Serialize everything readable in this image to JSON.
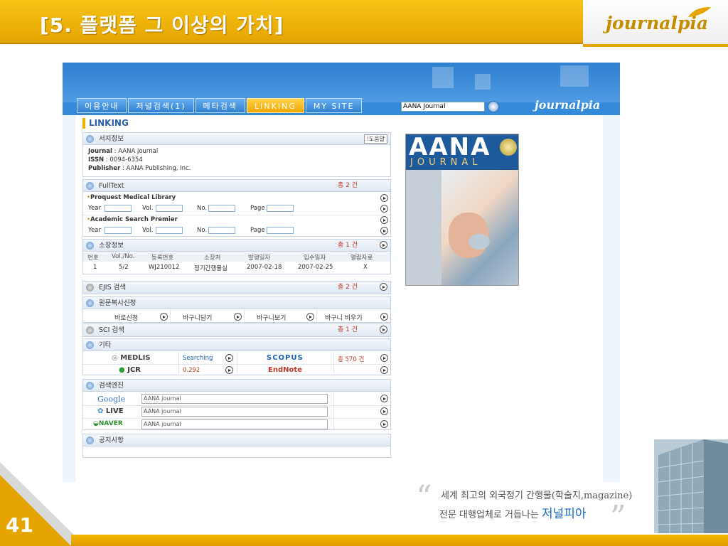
{
  "slide": {
    "title": "[5. 플랫폼 그 이상의 가치]",
    "logo": "journalpia",
    "page_number": "41",
    "quote_line1": "세계 최고의 외국정기 간행물(학술지,magazine)",
    "quote_line2_prefix": "전문 대행업체로 거듭나는 ",
    "quote_line2_highlight": "저널피아",
    "colors": {
      "accent": "#e5a400",
      "blue": "#2f7fd0"
    }
  },
  "site": {
    "nav": [
      "이용안내",
      "저널검색(1)",
      "메타검색",
      "LINKING",
      "MY SITE"
    ],
    "active_nav": "LINKING",
    "search_value": "AANA Journal",
    "logo": "journalpia",
    "page_heading": "LINKING"
  },
  "bib": {
    "title": "서지정보",
    "help": "도움말",
    "journal_label": "Journal",
    "journal_value": ": AANA journal",
    "issn_label": "ISSN",
    "issn_value": ": 0094-6354",
    "publisher_label": "Publisher",
    "publisher_value": ": AANA Publishing, Inc."
  },
  "fulltext": {
    "title": "FullText",
    "count": "총 2 건",
    "sources": [
      "Proquest Medical Library",
      "Academic Search Premier"
    ],
    "fields": [
      "Year",
      "Vol.",
      "No.",
      "Page"
    ]
  },
  "holdings": {
    "title": "소장정보",
    "count": "총 1 건",
    "headers": [
      "번호",
      "Vol./No.",
      "등록번호",
      "소장처",
      "발행일자",
      "입수일자",
      "열람자료"
    ],
    "row": [
      "1",
      "5/2",
      "WJ210012",
      "정기간행물실",
      "2007-02-18",
      "2007-02-25",
      "X"
    ]
  },
  "ejis": {
    "title": "EJIS 검색",
    "count": "총 2 건"
  },
  "docdelivery": {
    "title": "원문복사신청",
    "actions": [
      "바로신청",
      "바구니담기",
      "바구니보기",
      "바구니 비우기"
    ]
  },
  "sci": {
    "title": "SCI 검색",
    "count": "총 1 건"
  },
  "etc": {
    "title": "기타",
    "medlis": "MEDLIS",
    "medlis_value": "Searching",
    "scopus": "SCOPUS",
    "scopus_value": "총 570 건",
    "jcr": "JCR",
    "jcr_value": "0.292",
    "endnote": "EndNote"
  },
  "engines": {
    "title": "검색엔진",
    "items": [
      {
        "name": "Google",
        "value": "AANA journal"
      },
      {
        "name": "LIVE",
        "value": "AANA journal"
      },
      {
        "name": "NAVER",
        "value": "AANA journal"
      }
    ]
  },
  "notice": {
    "title": "공지사항"
  },
  "cover": {
    "title": "AANA",
    "subtitle": "JOURNAL"
  }
}
